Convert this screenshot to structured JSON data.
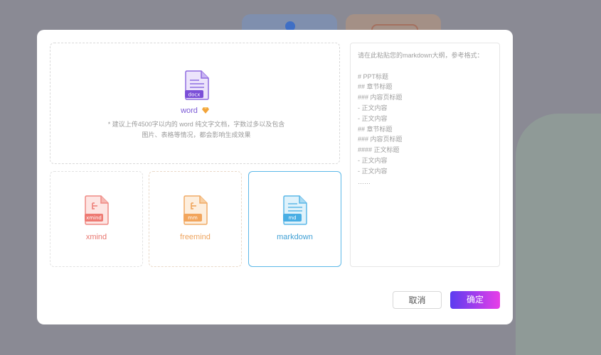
{
  "background": {
    "colors": {
      "page": "#8a8a94"
    }
  },
  "modal": {
    "upload_word": {
      "icon": "docx-file-icon",
      "icon_badge": "docx",
      "label": "word",
      "premium_icon": "diamond-icon",
      "hint_line1": "* 建议上传4500字以内的 word 纯文字文档，字数过多以及包含",
      "hint_line2": "图片、表格等情况，都会影响生成效果"
    },
    "formats": [
      {
        "name": "xmind",
        "badge": "xmind",
        "icon": "xmind-file-icon",
        "color": "#e8766f"
      },
      {
        "name": "freemind",
        "badge": "mm",
        "icon": "freemind-file-icon",
        "color": "#eea45e"
      },
      {
        "name": "markdown",
        "badge": "md",
        "icon": "markdown-file-icon",
        "color": "#3f9fd4",
        "selected": true
      }
    ],
    "markdown_input": {
      "placeholder_lines": [
        "请在此粘贴您的markdown大纲，参考格式：",
        "",
        "# PPT标题",
        "## 章节标题",
        "### 内容页标题",
        "- 正文内容",
        "- 正文内容",
        "## 章节标题",
        "### 内容页标题",
        "#### 正文标题",
        "- 正文内容",
        "- 正文内容",
        "……"
      ]
    },
    "buttons": {
      "cancel": "取消",
      "confirm": "确定"
    },
    "colors": {
      "accent_start": "#5b3cf0",
      "accent_end": "#e83ee8",
      "selected_border": "#5cb8e8"
    }
  }
}
